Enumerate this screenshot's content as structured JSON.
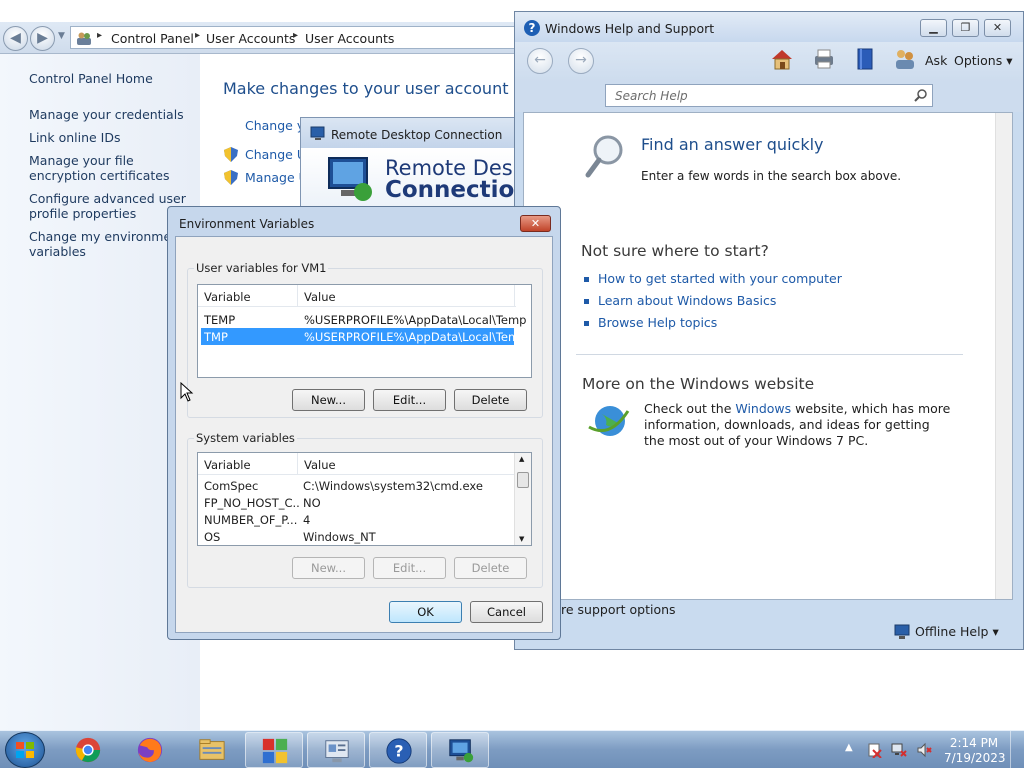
{
  "control_panel": {
    "breadcrumb": [
      "Control Panel",
      "User Accounts",
      "User Accounts"
    ],
    "sidebar": {
      "home": "Control Panel Home",
      "links": [
        "Manage your credentials",
        "Link online IDs",
        "Manage your file encryption certificates",
        "Configure advanced user profile properties",
        "Change my environment variables"
      ]
    },
    "main": {
      "title": "Make changes to your user account",
      "links": [
        "Change yo",
        "Change Us",
        "Manage Us"
      ]
    }
  },
  "remote_desktop": {
    "title": "Remote Desktop Connection",
    "banner_line1": "Remote Deskto",
    "banner_line2": "Connection"
  },
  "help": {
    "title": "Windows Help and Support",
    "toolbar": {
      "ask": "Ask",
      "options": "Options ▾"
    },
    "search_placeholder": "Search Help",
    "find_title": "Find an answer quickly",
    "find_sub": "Enter a few words in the search box above.",
    "not_sure": "Not sure where to start?",
    "links": [
      "How to get started with your computer",
      "Learn about Windows Basics",
      "Browse Help topics"
    ],
    "more_title": "More on the Windows website",
    "more_text_1": "Check out the ",
    "more_link": "Windows",
    "more_text_2": " website, which has more information, downloads, and ideas for getting the most out of your Windows 7 PC.",
    "support_options": "re support options",
    "offline_help": "Offline Help ▾"
  },
  "env_dialog": {
    "title": "Environment Variables",
    "user_group_label": "User variables for VM1",
    "system_group_label": "System variables",
    "columns": [
      "Variable",
      "Value"
    ],
    "user_vars": [
      {
        "name": "TEMP",
        "value": "%USERPROFILE%\\AppData\\Local\\Temp"
      },
      {
        "name": "TMP",
        "value": "%USERPROFILE%\\AppData\\Local\\Temp"
      }
    ],
    "system_vars": [
      {
        "name": "ComSpec",
        "value": "C:\\Windows\\system32\\cmd.exe"
      },
      {
        "name": "FP_NO_HOST_C...",
        "value": "NO"
      },
      {
        "name": "NUMBER_OF_P...",
        "value": "4"
      },
      {
        "name": "OS",
        "value": "Windows_NT"
      }
    ],
    "buttons": {
      "new": "New...",
      "edit": "Edit...",
      "delete": "Delete",
      "ok": "OK",
      "cancel": "Cancel"
    }
  },
  "taskbar": {
    "apps": [
      "chrome-icon",
      "firefox-icon",
      "file-explorer-icon",
      "control-panel-icon",
      "system-properties-icon",
      "help-icon",
      "remote-desktop-icon"
    ],
    "clock_time": "2:14 PM",
    "clock_date": "7/19/2023"
  },
  "colors": {
    "selection": "#3399ff",
    "link": "#1e5aa8",
    "taskbar": "#7d9cc2"
  }
}
